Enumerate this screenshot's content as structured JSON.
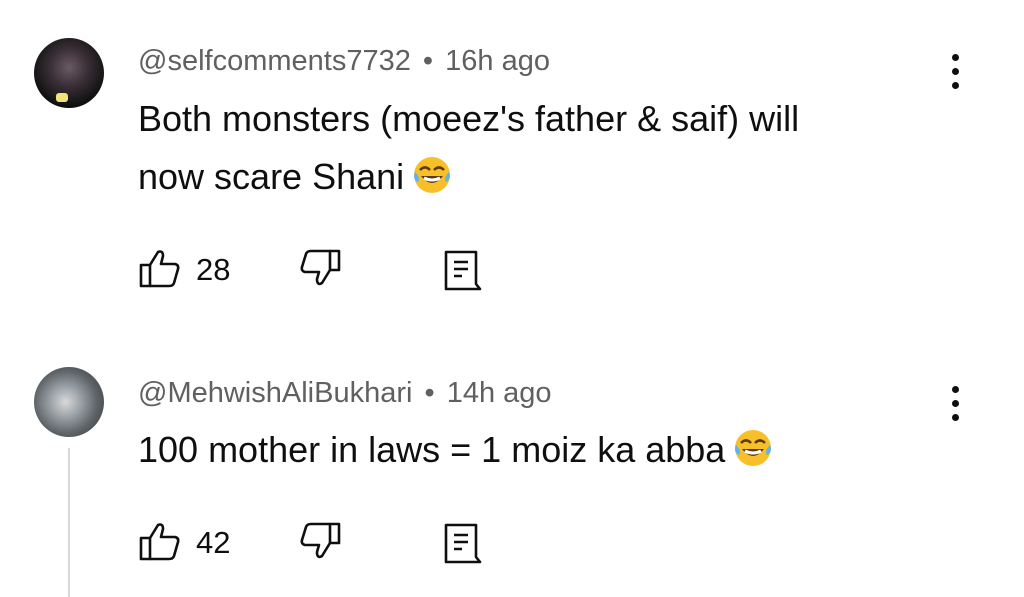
{
  "comments": [
    {
      "handle": "@selfcomments7732",
      "separator": "•",
      "time": "16h ago",
      "text_line1": "Both monsters (moeez's father & saif) will",
      "text_line2": "now scare Shani",
      "likes": "28",
      "avatar_icon": "avatar-image",
      "emoji_icon": "face-with-tears-of-joy-icon"
    },
    {
      "handle": "@MehwishAliBukhari",
      "separator": "•",
      "time": "14h ago",
      "text_line1": "100 mother in laws = 1 moiz ka abba",
      "likes": "42",
      "avatar_icon": "avatar-image",
      "emoji_icon": "face-with-tears-of-joy-icon"
    }
  ],
  "icons": {
    "like": "thumbs-up-icon",
    "dislike": "thumbs-down-icon",
    "reply": "reply-comment-icon",
    "more": "vertical-ellipsis-icon"
  },
  "colors": {
    "text": "#0f0f0f",
    "meta": "#606060",
    "thread_line": "#d9d9d9",
    "emoji_face": "#f7c02a"
  }
}
